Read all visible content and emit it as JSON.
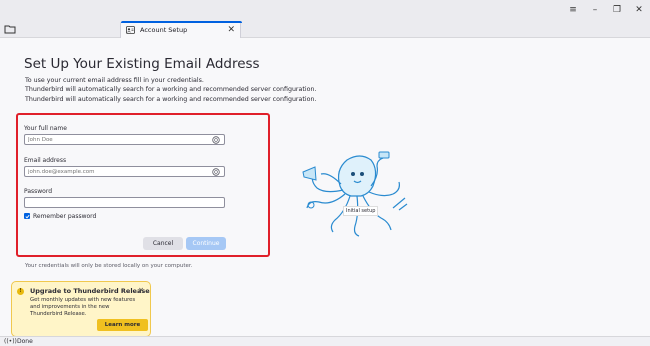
{
  "window": {
    "controls": {
      "menu": "≡",
      "minimize": "–",
      "restore": "❐",
      "close": "✕"
    }
  },
  "tab": {
    "title": "Account Setup",
    "close": "✕"
  },
  "form": {
    "title": "Set Up Your Existing Email Address",
    "description": [
      "To use your current email address fill in your credentials.",
      "Thunderbird will automatically search for a working and recommended server configuration.",
      "Thunderbird will automatically search for a working and recommended server configuration."
    ],
    "fullname_label": "Your full name",
    "fullname_placeholder": "John Doe",
    "email_label": "Email address",
    "email_placeholder": "john.doe@example.com",
    "password_label": "Password",
    "password_value": "",
    "remember_label": "Remember password",
    "remember_checked": true,
    "cancel_label": "Cancel",
    "continue_label": "Continue",
    "note": "Your credentials will only be stored locally on your computer."
  },
  "mascot": {
    "caption": "Initial setup"
  },
  "promo": {
    "title": "Upgrade to Thunderbird Release",
    "lines": [
      "Get monthly updates with new features",
      "and improvements in the new",
      "Thunderbird Release."
    ],
    "button_label": "Learn more",
    "close": "×"
  },
  "status": {
    "icon": "((•))",
    "text": "Done"
  },
  "colors": {
    "accent": "#0061e0",
    "highlight": "#e0202a",
    "promo_bg": "#fff5c8",
    "promo_button": "#f0c020"
  }
}
